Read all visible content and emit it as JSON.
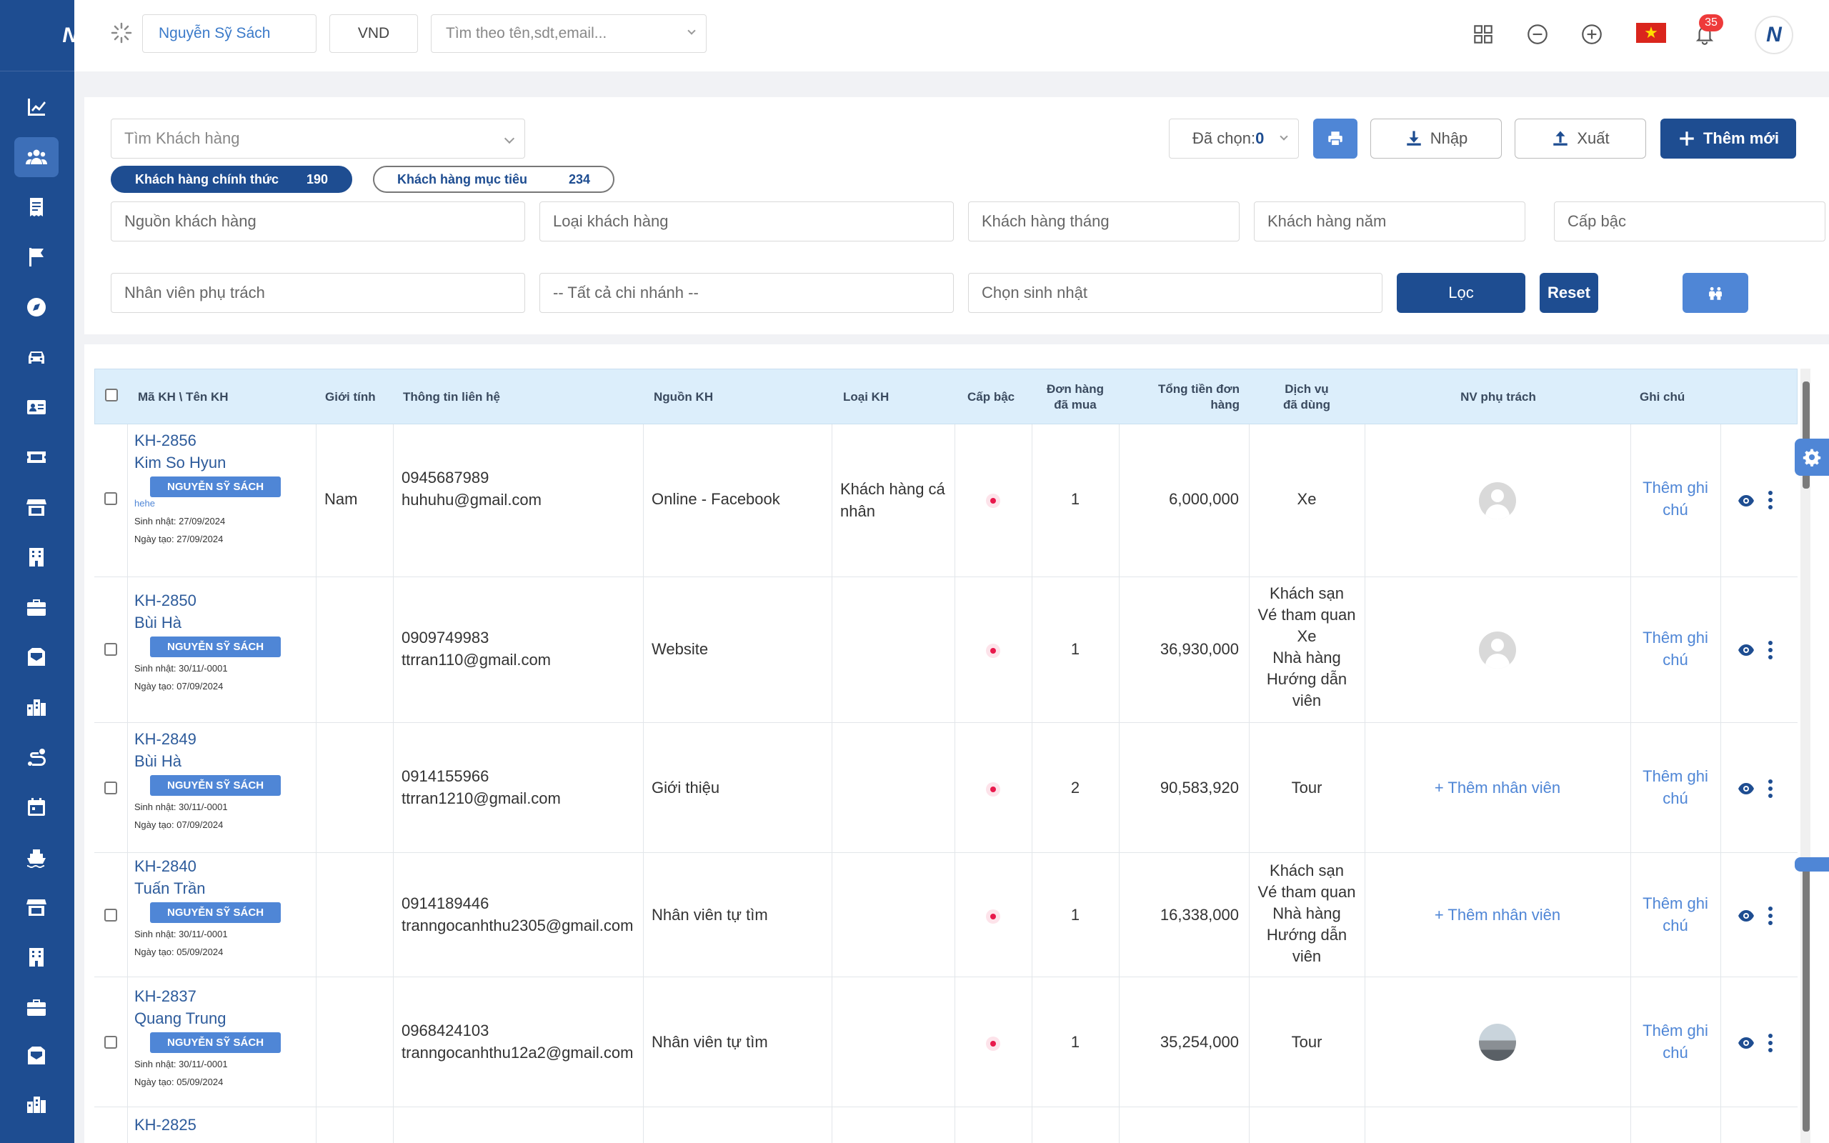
{
  "header": {
    "user_name": "Nguyễn Sỹ Sách",
    "currency": "VND",
    "search_placeholder": "Tìm theo tên,sdt,email...",
    "notification_count": "35",
    "logo_text": "N"
  },
  "sidebar": {
    "logo_text": "N",
    "items": [
      {
        "icon": "chart-line-icon"
      },
      {
        "icon": "users-icon",
        "active": true
      },
      {
        "icon": "receipt-icon"
      },
      {
        "icon": "flag-icon"
      },
      {
        "icon": "compass-icon"
      },
      {
        "icon": "car-icon"
      },
      {
        "icon": "id-card-icon"
      },
      {
        "icon": "ticket-icon"
      },
      {
        "icon": "store-icon"
      },
      {
        "icon": "building-icon"
      },
      {
        "icon": "briefcase-icon"
      },
      {
        "icon": "mail-box-icon"
      },
      {
        "icon": "city-icon"
      },
      {
        "icon": "route-icon"
      },
      {
        "icon": "calendar-icon"
      },
      {
        "icon": "ship-icon"
      },
      {
        "icon": "store-icon"
      },
      {
        "icon": "building-icon"
      },
      {
        "icon": "briefcase-icon"
      },
      {
        "icon": "mail-box-icon"
      },
      {
        "icon": "city-icon"
      }
    ]
  },
  "filters": {
    "customer_search_placeholder": "Tìm Khách hàng",
    "selected_label": "Đã chọn:",
    "selected_count": "0",
    "import_label": "Nhập",
    "export_label": "Xuất",
    "add_label": "Thêm mới",
    "tab_official_label": "Khách hàng chính thức",
    "tab_official_count": "190",
    "tab_target_label": "Khách hàng mục tiêu",
    "tab_target_count": "234",
    "source_placeholder": "Nguồn khách hàng",
    "type_placeholder": "Loại khách hàng",
    "month_placeholder": "Khách hàng tháng",
    "year_placeholder": "Khách hàng năm",
    "rank_placeholder": "Cấp bậc",
    "staff_placeholder": "Nhân viên phụ trách",
    "branch_placeholder": "-- Tất cả chi nhánh --",
    "birthday_placeholder": "Chọn sinh nhật",
    "filter_label": "Lọc",
    "reset_label": "Reset"
  },
  "table": {
    "headers": {
      "code_name": "Mã KH \\ Tên KH",
      "gender": "Giới tính",
      "contact": "Thông tin liên hệ",
      "source": "Nguồn KH",
      "type": "Loại KH",
      "rank": "Cấp bậc",
      "orders_line1": "Đơn hàng",
      "orders_line2": "đã mua",
      "total_line1": "Tổng tiền đơn",
      "total_line2": "hàng",
      "services_line1": "Dịch vụ",
      "services_line2": "đã dùng",
      "staff": "NV phụ trách",
      "note": "Ghi chú"
    },
    "add_staff_label": "+ Thêm nhân viên",
    "add_note_line1": "Thêm ghi",
    "add_note_line2": "chú",
    "rows": [
      {
        "code": "KH-2856",
        "name": "Kim So Hyun",
        "tag": "NGUYỄN SỸ SÁCH",
        "extra": "hehe",
        "birthday": "Sinh nhật: 27/09/2024",
        "created": "Ngày tạo: 27/09/2024",
        "gender": "Nam",
        "phone": "0945687989",
        "email": "huhuhu@gmail.com",
        "source": "Online - Facebook",
        "type_line1": "Khách hàng cá",
        "type_line2": "nhân",
        "orders": "1",
        "total": "6,000,000",
        "services": [
          "Xe"
        ],
        "staff": "avatar"
      },
      {
        "code": "KH-2850",
        "name": "Bùi Hà",
        "tag": "NGUYỄN SỸ SÁCH",
        "birthday": "Sinh nhật: 30/11/-0001",
        "created": "Ngày tạo: 07/09/2024",
        "gender": "",
        "phone": "0909749983",
        "email": "ttrran110@gmail.com",
        "source": "Website",
        "orders": "1",
        "total": "36,930,000",
        "services": [
          "Khách sạn",
          "Vé tham quan",
          "Xe",
          "Nhà hàng",
          "Hướng dẫn",
          "viên"
        ],
        "staff": "avatar"
      },
      {
        "code": "KH-2849",
        "name": "Bùi Hà",
        "tag": "NGUYỄN SỸ SÁCH",
        "birthday": "Sinh nhật: 30/11/-0001",
        "created": "Ngày tạo: 07/09/2024",
        "gender": "",
        "phone": "0914155966",
        "email": "ttrran1210@gmail.com",
        "source": "Giới thiệu",
        "orders": "2",
        "total": "90,583,920",
        "services": [
          "Tour"
        ],
        "staff": "add"
      },
      {
        "code": "KH-2840",
        "name": "Tuấn Trần",
        "tag": "NGUYỄN SỸ SÁCH",
        "birthday": "Sinh nhật: 30/11/-0001",
        "created": "Ngày tạo: 05/09/2024",
        "gender": "",
        "phone": "0914189446",
        "email": "tranngocanhthu2305@gmail.com",
        "source": "Nhân viên tự tìm",
        "orders": "1",
        "total": "16,338,000",
        "services": [
          "Khách sạn",
          "Vé tham quan",
          "Nhà hàng",
          "Hướng dẫn",
          "viên"
        ],
        "staff": "add"
      },
      {
        "code": "KH-2837",
        "name": "Quang Trung",
        "tag": "NGUYỄN SỸ SÁCH",
        "birthday": "Sinh nhật: 30/11/-0001",
        "created": "Ngày tạo: 05/09/2024",
        "gender": "",
        "phone": "0968424103",
        "email": "tranngocanhthu12a2@gmail.com",
        "source": "Nhân viên tự tìm",
        "orders": "1",
        "total": "35,254,000",
        "services": [
          "Tour"
        ],
        "staff": "photo"
      },
      {
        "code": "KH-2825"
      }
    ]
  },
  "colors": {
    "sidebar": "#1e4d91",
    "primary": "#1e4d91",
    "accent": "#4f86d6",
    "badge": "#ee3a3a",
    "rank": "#e8194c"
  }
}
